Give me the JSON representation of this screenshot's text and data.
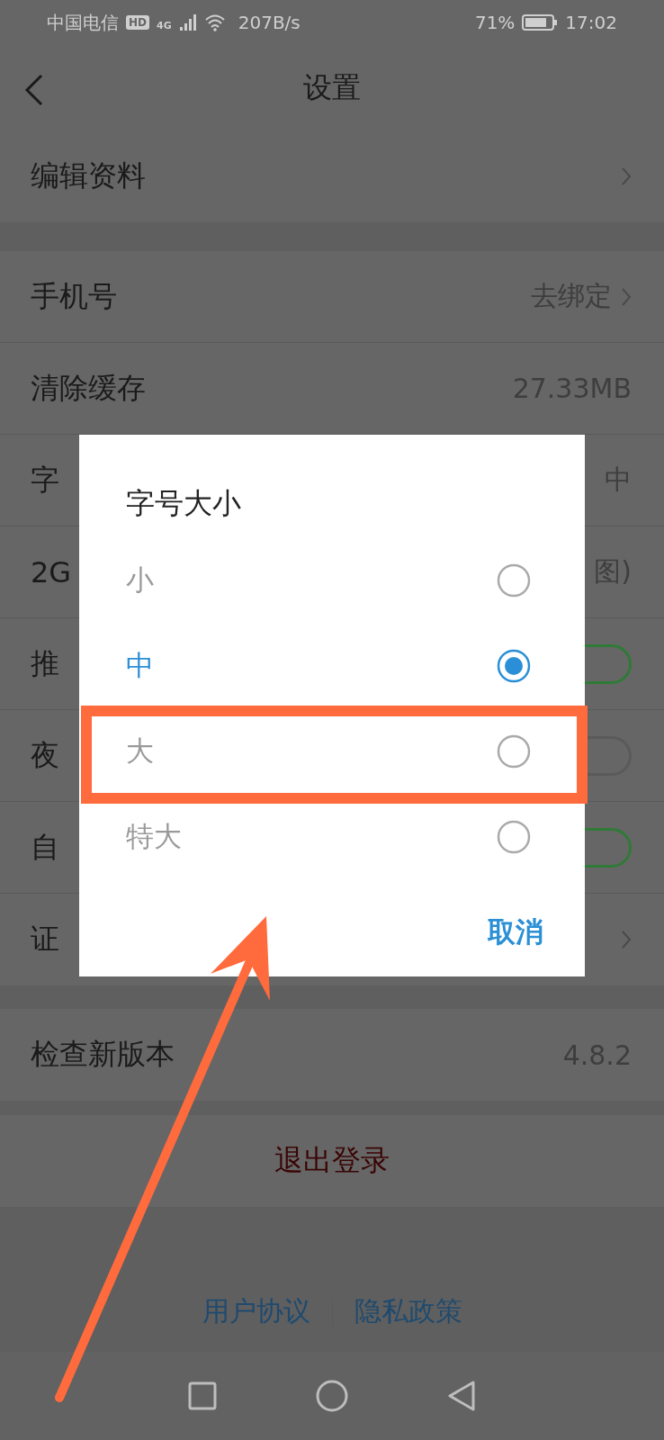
{
  "status_bar": {
    "carrier": "中国电信",
    "network_badge": "HD",
    "network_type": "4G",
    "speed": "207B/s",
    "battery": "71%",
    "time": "17:02"
  },
  "header": {
    "title": "设置"
  },
  "sections": [
    {
      "rows": [
        {
          "label": "编辑资料",
          "kind": "link"
        }
      ]
    },
    {
      "rows": [
        {
          "label": "手机号",
          "value": "去绑定",
          "kind": "link"
        },
        {
          "label": "清除缓存",
          "value": "27.33MB",
          "kind": "value"
        },
        {
          "label": "字",
          "value": "中",
          "kind": "value"
        },
        {
          "label": "2G",
          "value": "图)",
          "kind": "value"
        },
        {
          "label": "推",
          "kind": "toggle",
          "on": true
        },
        {
          "label": "夜",
          "kind": "toggle",
          "on": false
        },
        {
          "label": "自",
          "kind": "toggle",
          "on": true
        },
        {
          "label": "证",
          "kind": "link"
        }
      ]
    },
    {
      "rows": [
        {
          "label": "检查新版本",
          "value": "4.8.2",
          "kind": "value"
        }
      ]
    },
    {
      "rows": [
        {
          "label": "退出登录",
          "kind": "action"
        }
      ]
    }
  ],
  "footer_links": [
    "用户协议",
    "隐私政策"
  ],
  "dialog": {
    "title": "字号大小",
    "options": [
      {
        "label": "小",
        "selected": false,
        "highlighted": false
      },
      {
        "label": "中",
        "selected": true,
        "highlighted": false
      },
      {
        "label": "大",
        "selected": false,
        "highlighted": true
      },
      {
        "label": "特大",
        "selected": false,
        "highlighted": false
      }
    ],
    "cancel": "取消"
  },
  "annotations": [
    {
      "kind": "arrow"
    }
  ]
}
